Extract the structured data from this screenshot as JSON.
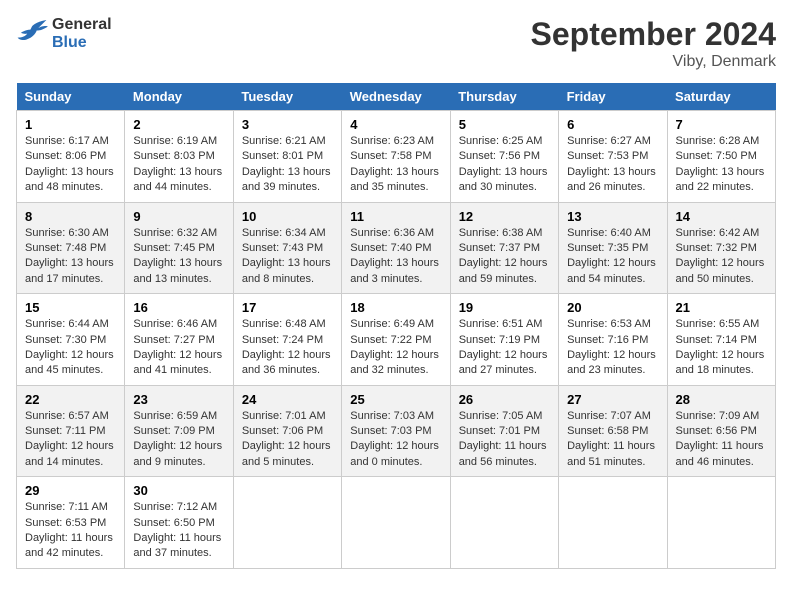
{
  "header": {
    "logo_line1": "General",
    "logo_line2": "Blue",
    "month": "September 2024",
    "location": "Viby, Denmark"
  },
  "days_of_week": [
    "Sunday",
    "Monday",
    "Tuesday",
    "Wednesday",
    "Thursday",
    "Friday",
    "Saturday"
  ],
  "weeks": [
    [
      {
        "day": "1",
        "sunrise": "6:17 AM",
        "sunset": "8:06 PM",
        "daylight": "13 hours and 48 minutes."
      },
      {
        "day": "2",
        "sunrise": "6:19 AM",
        "sunset": "8:03 PM",
        "daylight": "13 hours and 44 minutes."
      },
      {
        "day": "3",
        "sunrise": "6:21 AM",
        "sunset": "8:01 PM",
        "daylight": "13 hours and 39 minutes."
      },
      {
        "day": "4",
        "sunrise": "6:23 AM",
        "sunset": "7:58 PM",
        "daylight": "13 hours and 35 minutes."
      },
      {
        "day": "5",
        "sunrise": "6:25 AM",
        "sunset": "7:56 PM",
        "daylight": "13 hours and 30 minutes."
      },
      {
        "day": "6",
        "sunrise": "6:27 AM",
        "sunset": "7:53 PM",
        "daylight": "13 hours and 26 minutes."
      },
      {
        "day": "7",
        "sunrise": "6:28 AM",
        "sunset": "7:50 PM",
        "daylight": "13 hours and 22 minutes."
      }
    ],
    [
      {
        "day": "8",
        "sunrise": "6:30 AM",
        "sunset": "7:48 PM",
        "daylight": "13 hours and 17 minutes."
      },
      {
        "day": "9",
        "sunrise": "6:32 AM",
        "sunset": "7:45 PM",
        "daylight": "13 hours and 13 minutes."
      },
      {
        "day": "10",
        "sunrise": "6:34 AM",
        "sunset": "7:43 PM",
        "daylight": "13 hours and 8 minutes."
      },
      {
        "day": "11",
        "sunrise": "6:36 AM",
        "sunset": "7:40 PM",
        "daylight": "13 hours and 3 minutes."
      },
      {
        "day": "12",
        "sunrise": "6:38 AM",
        "sunset": "7:37 PM",
        "daylight": "12 hours and 59 minutes."
      },
      {
        "day": "13",
        "sunrise": "6:40 AM",
        "sunset": "7:35 PM",
        "daylight": "12 hours and 54 minutes."
      },
      {
        "day": "14",
        "sunrise": "6:42 AM",
        "sunset": "7:32 PM",
        "daylight": "12 hours and 50 minutes."
      }
    ],
    [
      {
        "day": "15",
        "sunrise": "6:44 AM",
        "sunset": "7:30 PM",
        "daylight": "12 hours and 45 minutes."
      },
      {
        "day": "16",
        "sunrise": "6:46 AM",
        "sunset": "7:27 PM",
        "daylight": "12 hours and 41 minutes."
      },
      {
        "day": "17",
        "sunrise": "6:48 AM",
        "sunset": "7:24 PM",
        "daylight": "12 hours and 36 minutes."
      },
      {
        "day": "18",
        "sunrise": "6:49 AM",
        "sunset": "7:22 PM",
        "daylight": "12 hours and 32 minutes."
      },
      {
        "day": "19",
        "sunrise": "6:51 AM",
        "sunset": "7:19 PM",
        "daylight": "12 hours and 27 minutes."
      },
      {
        "day": "20",
        "sunrise": "6:53 AM",
        "sunset": "7:16 PM",
        "daylight": "12 hours and 23 minutes."
      },
      {
        "day": "21",
        "sunrise": "6:55 AM",
        "sunset": "7:14 PM",
        "daylight": "12 hours and 18 minutes."
      }
    ],
    [
      {
        "day": "22",
        "sunrise": "6:57 AM",
        "sunset": "7:11 PM",
        "daylight": "12 hours and 14 minutes."
      },
      {
        "day": "23",
        "sunrise": "6:59 AM",
        "sunset": "7:09 PM",
        "daylight": "12 hours and 9 minutes."
      },
      {
        "day": "24",
        "sunrise": "7:01 AM",
        "sunset": "7:06 PM",
        "daylight": "12 hours and 5 minutes."
      },
      {
        "day": "25",
        "sunrise": "7:03 AM",
        "sunset": "7:03 PM",
        "daylight": "12 hours and 0 minutes."
      },
      {
        "day": "26",
        "sunrise": "7:05 AM",
        "sunset": "7:01 PM",
        "daylight": "11 hours and 56 minutes."
      },
      {
        "day": "27",
        "sunrise": "7:07 AM",
        "sunset": "6:58 PM",
        "daylight": "11 hours and 51 minutes."
      },
      {
        "day": "28",
        "sunrise": "7:09 AM",
        "sunset": "6:56 PM",
        "daylight": "11 hours and 46 minutes."
      }
    ],
    [
      {
        "day": "29",
        "sunrise": "7:11 AM",
        "sunset": "6:53 PM",
        "daylight": "11 hours and 42 minutes."
      },
      {
        "day": "30",
        "sunrise": "7:12 AM",
        "sunset": "6:50 PM",
        "daylight": "11 hours and 37 minutes."
      },
      null,
      null,
      null,
      null,
      null
    ]
  ],
  "labels": {
    "sunrise": "Sunrise:",
    "sunset": "Sunset:",
    "daylight": "Daylight:"
  }
}
